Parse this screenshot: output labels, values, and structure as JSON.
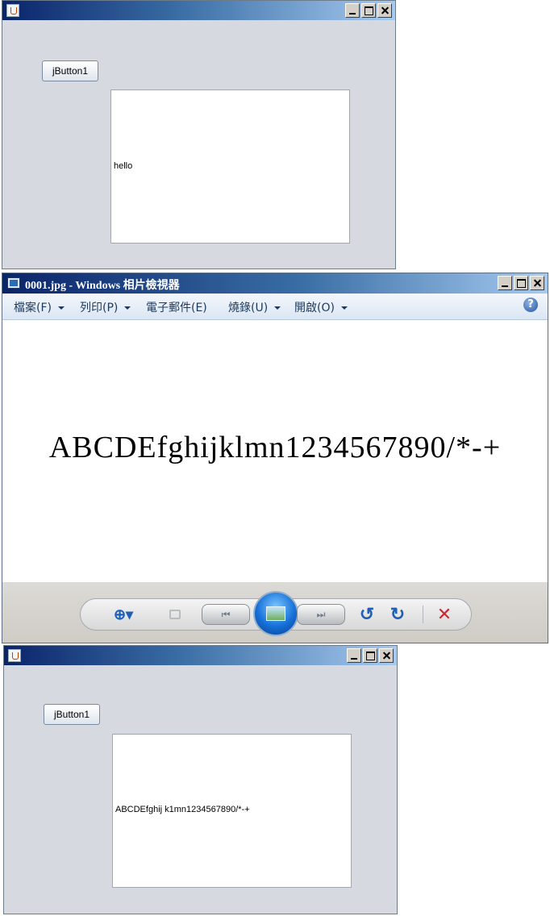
{
  "window1": {
    "button_label": "jButton1",
    "text": "hello"
  },
  "photo_viewer": {
    "title": "0001.jpg - Windows 相片檢視器",
    "menu": [
      {
        "label": "檔案(F)",
        "has_dropdown": true
      },
      {
        "label": "列印(P)",
        "has_dropdown": true
      },
      {
        "label": "電子郵件(E)",
        "has_dropdown": false
      },
      {
        "label": "燒錄(U)",
        "has_dropdown": true
      },
      {
        "label": "開啟(O)",
        "has_dropdown": true
      }
    ],
    "help_icon": "?",
    "image_text": "ABCDEfghijklmn1234567890/*-+",
    "controls": {
      "zoom_icon": "⊕▾",
      "rotate_ccw_icon": "↺",
      "rotate_cw_icon": "↻",
      "delete_icon": "✕",
      "prev_icon": "⏮",
      "next_icon": "⏭"
    },
    "colors": {
      "title_bar": "#0a246a",
      "delete": "#d0262e",
      "accent": "#1f5fb8"
    }
  },
  "window2": {
    "button_label": "jButton1",
    "text": "ABCDEfghij k1mn1234567890/*-+"
  }
}
